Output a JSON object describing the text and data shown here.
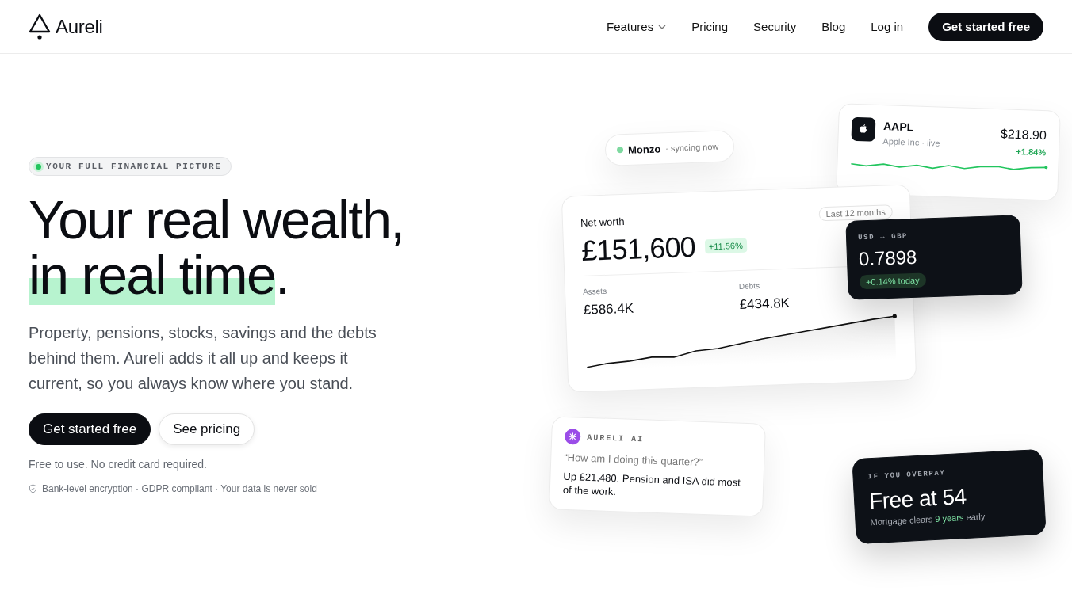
{
  "header": {
    "brand": "Aureli",
    "nav": [
      {
        "label": "Features",
        "kind": "dropdown"
      },
      {
        "label": "Pricing",
        "kind": "link"
      },
      {
        "label": "Security",
        "kind": "link"
      },
      {
        "label": "Blog",
        "kind": "link"
      },
      {
        "label": "Log in",
        "kind": "link"
      }
    ],
    "cta": "Get started free"
  },
  "hero": {
    "eyebrow": "YOUR FULL FINANCIAL PICTURE",
    "headline": {
      "line_1": "Your real wealth,",
      "highlight": "in real time",
      "end": "."
    },
    "lede": "Property, pensions, stocks, savings and the debts behind them. Aureli adds it all up and keeps it current, so you always know where you stand.",
    "primary_button": "Get started free",
    "secondary_button": "See pricing",
    "note": "Free to use. No credit card required.",
    "trust": "Bank-level encryption · GDPR compliant · Your data is never sold"
  },
  "cards": {
    "sync": {
      "name": "Monzo",
      "status": "· syncing now"
    },
    "stock": {
      "ticker": "AAPL",
      "company": "Apple Inc · live",
      "price": "$218.90",
      "change": "+1.84%"
    },
    "net_worth": {
      "title": "Net worth",
      "range": "Last 12 months",
      "value": "£151,600",
      "change": "+11.56%",
      "assets_label": "Assets",
      "assets": "£586.4K",
      "debts_label": "Debts",
      "debts": "£434.8K"
    },
    "fx": {
      "pair": "USD → GBP",
      "rate": "0.7898",
      "change": "+0.14% today"
    },
    "ai": {
      "label": "AURELI AI",
      "question": "“How am I doing this quarter?”",
      "answer": "Up £21,480. Pension and ISA did most of the work."
    },
    "overpay": {
      "label": "IF YOU OVERPAY",
      "title": "Free at 54",
      "detail": "Mortgage clears **9 years** early"
    }
  }
}
